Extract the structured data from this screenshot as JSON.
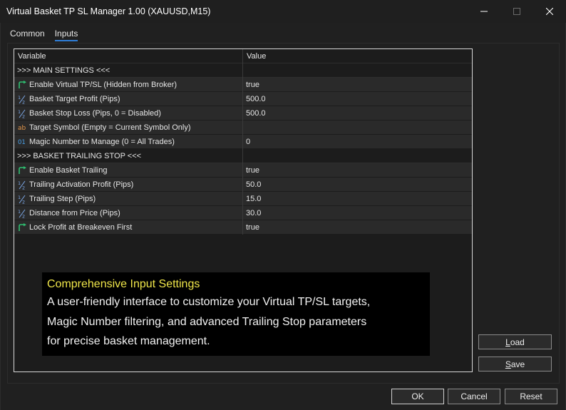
{
  "window": {
    "title": "Virtual Basket TP SL Manager 1.00 (XAUUSD,M15)"
  },
  "tabs": [
    {
      "label": "Common",
      "active": false
    },
    {
      "label": "Inputs",
      "active": true
    }
  ],
  "table": {
    "headers": {
      "variable": "Variable",
      "value": "Value"
    },
    "rows": [
      {
        "type": "section",
        "icon": "",
        "variable": ">>> MAIN SETTINGS <<<",
        "value": ""
      },
      {
        "type": "item",
        "icon": "bool-arrow-icon",
        "variable": "Enable Virtual TP/SL (Hidden from Broker)",
        "value": "true"
      },
      {
        "type": "item",
        "icon": "half-fraction-icon",
        "variable": "Basket Target Profit (Pips)",
        "value": "500.0"
      },
      {
        "type": "item",
        "icon": "half-fraction-icon",
        "variable": "Basket Stop Loss (Pips, 0 = Disabled)",
        "value": "500.0"
      },
      {
        "type": "item",
        "icon": "string-ab-icon",
        "variable": "Target Symbol (Empty = Current Symbol Only)",
        "value": ""
      },
      {
        "type": "item",
        "icon": "integer-01-icon",
        "variable": "Magic Number to Manage (0 = All Trades)",
        "value": "0"
      },
      {
        "type": "section",
        "icon": "",
        "variable": ">>> BASKET TRAILING STOP <<<",
        "value": ""
      },
      {
        "type": "item",
        "icon": "bool-arrow-icon",
        "variable": "Enable Basket Trailing",
        "value": "true"
      },
      {
        "type": "item",
        "icon": "half-fraction-icon",
        "variable": "Trailing Activation Profit (Pips)",
        "value": "50.0"
      },
      {
        "type": "item",
        "icon": "half-fraction-icon",
        "variable": "Trailing Step (Pips)",
        "value": "15.0"
      },
      {
        "type": "item",
        "icon": "half-fraction-icon",
        "variable": "Distance from Price (Pips)",
        "value": "30.0"
      },
      {
        "type": "item",
        "icon": "bool-arrow-icon",
        "variable": "Lock Profit at Breakeven First",
        "value": "true"
      }
    ]
  },
  "overlay": {
    "heading": "Comprehensive Input Settings",
    "lines": [
      "A user-friendly interface to customize your Virtual TP/SL targets,",
      "Magic Number filtering, and advanced Trailing Stop parameters",
      "for precise basket management."
    ]
  },
  "buttons": {
    "load": {
      "pre": "",
      "accel": "L",
      "post": "oad"
    },
    "save": {
      "pre": "",
      "accel": "S",
      "post": "ave"
    },
    "ok": "OK",
    "cancel": "Cancel",
    "reset": "Reset"
  },
  "colors": {
    "bool_icon": "#2fbf71",
    "fraction_icon": "#7da9e8",
    "string_icon": "#e3964a",
    "integer_icon": "#4aa0e8",
    "overlay_heading": "#f0e64a",
    "tab_underline": "#2f7ed8"
  }
}
